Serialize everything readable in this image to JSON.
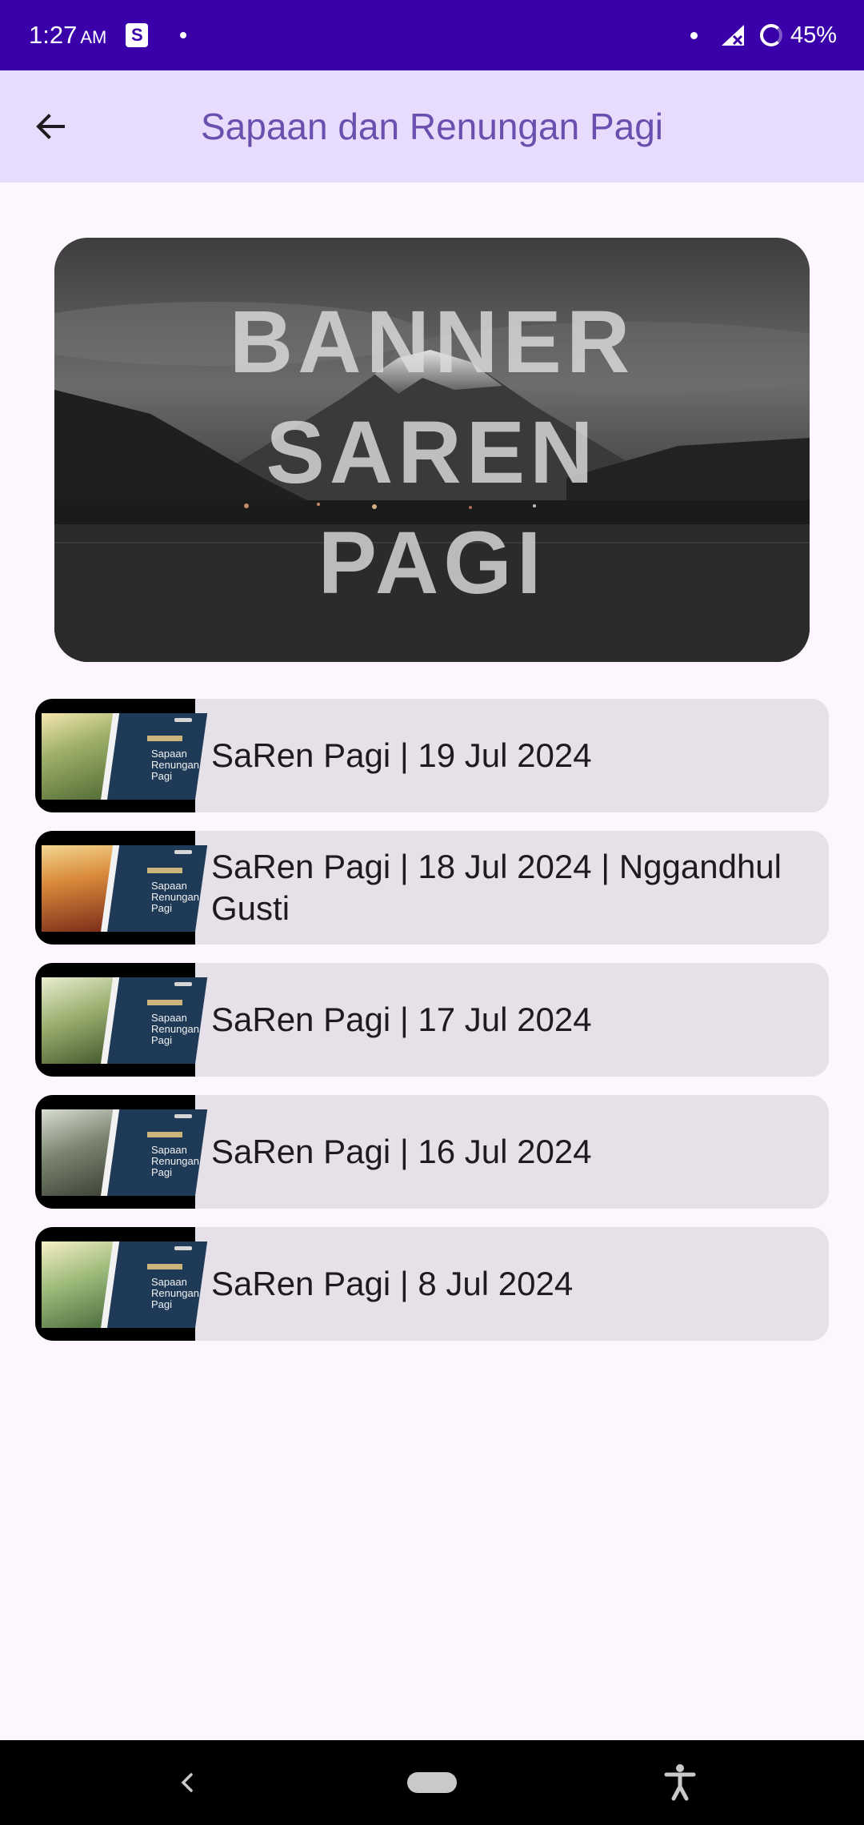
{
  "status_bar": {
    "time": "1:27",
    "ampm": "AM",
    "shop_icon_glyph": "S",
    "battery": "45%"
  },
  "app_bar": {
    "title": "Sapaan dan Renungan Pagi",
    "back_icon": "arrow-left-icon"
  },
  "banner": {
    "lines": [
      "BANNER",
      "SAREN",
      "PAGI"
    ]
  },
  "list": {
    "items": [
      {
        "label": "SaRen Pagi | 19 Jul 2024",
        "thumb_tone": "#6f8a45"
      },
      {
        "label": "SaRen Pagi | 18 Jul 2024 | Nggandhul Gusti",
        "thumb_tone": "#b4552c"
      },
      {
        "label": "SaRen Pagi | 17 Jul 2024",
        "thumb_tone": "#7d9a52"
      },
      {
        "label": "SaRen Pagi | 16 Jul 2024",
        "thumb_tone": "#66705e"
      },
      {
        "label": "SaRen Pagi | 8 Jul 2024",
        "thumb_tone": "#6e8d5a"
      }
    ],
    "thumb_title_1": "Sapaan",
    "thumb_title_2": "Renungan Pagi"
  },
  "colors": {
    "status_bar": "#3a00aa",
    "app_bar": "#e8dcfc",
    "title": "#6a4fae",
    "item_bg": "#e6e0e9",
    "page_bg": "#fdf6fe"
  },
  "nav_bar": {
    "back_icon": "chevron-left-icon",
    "home_icon": "home-pill-icon",
    "accessibility_icon": "accessibility-icon"
  }
}
